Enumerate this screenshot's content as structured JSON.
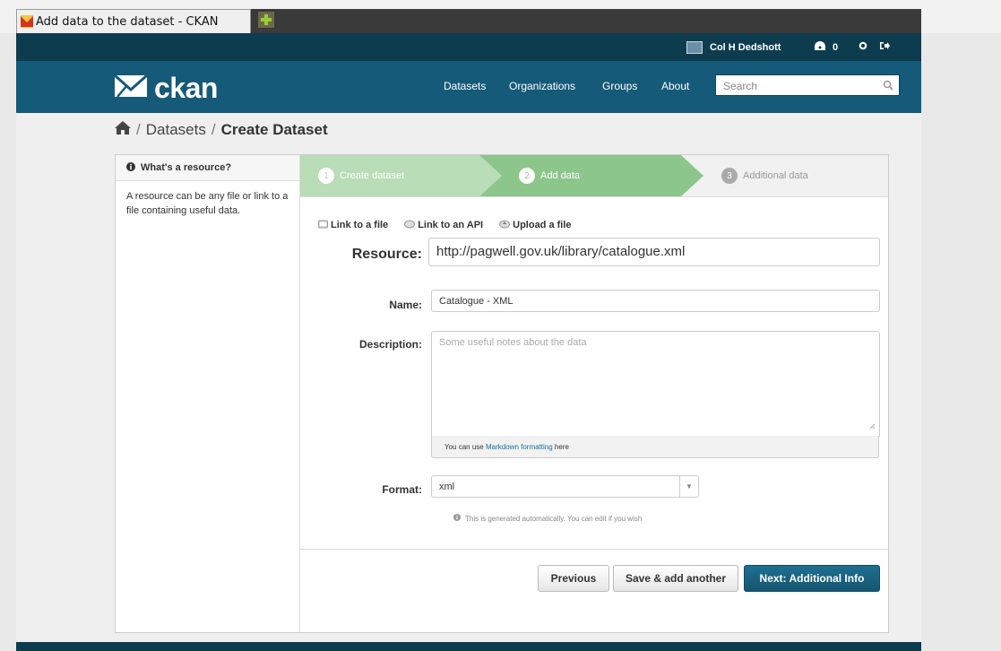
{
  "browser": {
    "tab_title": "Add data to the dataset - CKAN"
  },
  "account": {
    "user_name": "Col H Dedshott",
    "dashboard_count": "0"
  },
  "brand": {
    "logo_text": "ckan"
  },
  "nav": {
    "items": [
      "Datasets",
      "Organizations",
      "Groups",
      "About"
    ]
  },
  "search": {
    "placeholder": "Search"
  },
  "breadcrumb": {
    "separator": "/",
    "datasets": "Datasets",
    "current": "Create Dataset"
  },
  "sidebar": {
    "heading": "What's a resource?",
    "body": "A resource can be any file or link to a file containing useful data."
  },
  "stages": [
    {
      "number": "1",
      "label": "Create dataset",
      "state": "complete"
    },
    {
      "number": "2",
      "label": "Add data",
      "state": "active"
    },
    {
      "number": "3",
      "label": "Additional data",
      "state": "upcoming"
    }
  ],
  "resource_tabs": [
    "Link to a file",
    "Link to an API",
    "Upload a file"
  ],
  "form": {
    "resource_label": "Resource:",
    "resource_value": "http://pagwell.gov.uk/library/catalogue.xml",
    "name_label": "Name:",
    "name_value": "Catalogue - XML",
    "description_label": "Description:",
    "description_placeholder": "Some useful notes about the data",
    "markdown_note_prefix": "You can use",
    "markdown_link": "Markdown formatting",
    "markdown_note_suffix": "here",
    "format_label": "Format:",
    "format_value": "xml",
    "format_help": "This is generated automatically. You can edit if you wish"
  },
  "actions": {
    "previous": "Previous",
    "save_add_another": "Save & add another",
    "next": "Next: Additional Info"
  },
  "colors": {
    "masthead": "#155a78",
    "account_bar": "#0d3c4f",
    "stage_active": "#8cc68a",
    "stage_complete": "#b9ddb6",
    "primary_button": "#1a6283"
  }
}
